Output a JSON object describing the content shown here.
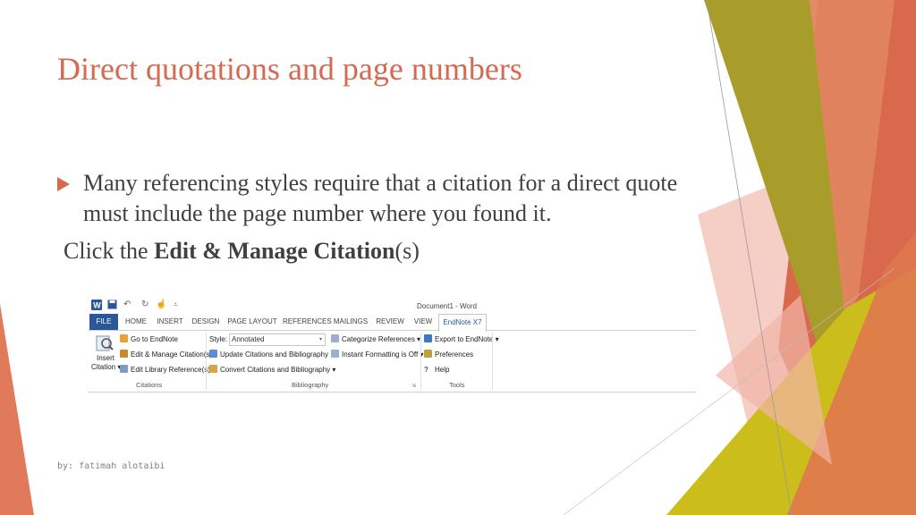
{
  "slide": {
    "title": "Direct quotations and page numbers",
    "bullet": "Many referencing styles require that a citation for a direct quote  must include the page number where you found it.",
    "click_prefix": "Click the ",
    "click_bold": "Edit & Manage Citation",
    "click_suffix": "(s)",
    "footer": "by: fatimah alotaibi"
  },
  "word": {
    "doc_title": "Document1 - Word",
    "tabs": [
      "FILE",
      "HOME",
      "INSERT",
      "DESIGN",
      "PAGE LAYOUT",
      "REFERENCES",
      "MAILINGS",
      "REVIEW",
      "VIEW",
      "EndNote X7"
    ],
    "citations": {
      "insert_line1": "Insert",
      "insert_line2": "Citation",
      "go_to": "Go to EndNote",
      "edit_manage": "Edit & Manage Citation(s)",
      "edit_library": "Edit Library Reference(s)",
      "group_label": "Citations"
    },
    "bibliography": {
      "style_label": "Style:",
      "style_value": "Annotated",
      "update": "Update Citations and Bibliography",
      "convert": "Convert Citations and Bibliography",
      "categorize": "Categorize References",
      "instant": "Instant Formatting is Off",
      "group_label": "Bibliography"
    },
    "tools": {
      "export": "Export to EndNote",
      "preferences": "Preferences",
      "help": "Help",
      "group_label": "Tools"
    }
  },
  "colors": {
    "accent": "#d46a4f",
    "word_blue": "#2b579a",
    "olive": "#a49b2a",
    "yellow": "#c9bd1e",
    "salmon": "#e07a5a",
    "pink": "#f0b3a6"
  }
}
